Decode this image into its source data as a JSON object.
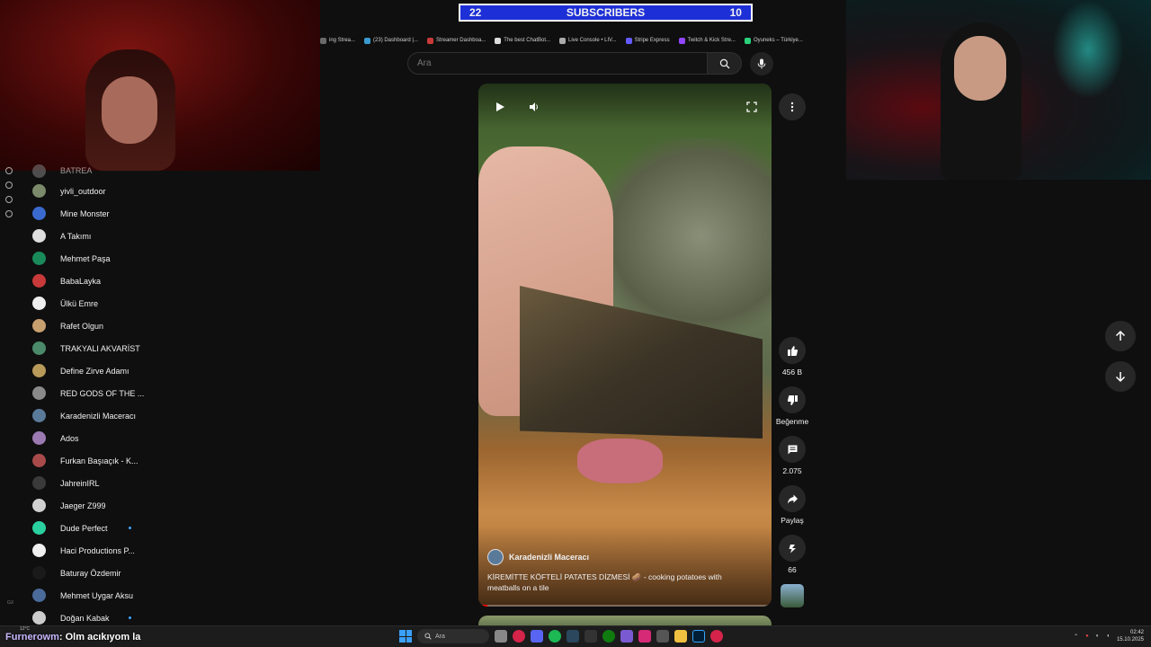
{
  "subscriber_bar": {
    "left": "22",
    "title": "SUBSCRIBERS",
    "right": "10"
  },
  "bookmarks": [
    "ing Strea...",
    "(23) Dashboard |...",
    "Streamer Dashboa...",
    "The best ChatBot...",
    "Live Console • LIV...",
    "Stripe Express",
    "Twitch & Kick Stre...",
    "Oyuneks – Türkiye..."
  ],
  "search": {
    "placeholder": "Ara"
  },
  "subscriptions": [
    {
      "name": "yivli_outdoor",
      "color": "#7a8a6a"
    },
    {
      "name": "Mine Monster",
      "color": "#3a6ad0"
    },
    {
      "name": "A Takımı",
      "color": "#dddddd"
    },
    {
      "name": "Mehmet Paşa",
      "color": "#1a8a5a"
    },
    {
      "name": "BabaLayka",
      "color": "#c83a3a"
    },
    {
      "name": "Ülkü Emre",
      "color": "#eeeeee"
    },
    {
      "name": "Rafet Olgun",
      "color": "#c8a070"
    },
    {
      "name": "TRAKYALI AKVARİST",
      "color": "#4a8a6a"
    },
    {
      "name": "Define Zirve Adamı",
      "color": "#b89a5a"
    },
    {
      "name": "RED GODS OF THE ...",
      "color": "#8a8a8a"
    },
    {
      "name": "Karadenizli Maceracı",
      "color": "#5a7a9a"
    },
    {
      "name": "Ados",
      "color": "#9a7ab0"
    },
    {
      "name": "Furkan Başıaçık - K...",
      "color": "#a84a4a"
    },
    {
      "name": "JahreinIRL",
      "color": "#3a3a3a"
    },
    {
      "name": "Jaeger Z999",
      "color": "#d0d0d0"
    },
    {
      "name": "Dude Perfect",
      "color": "#2ad0a0",
      "dot": true
    },
    {
      "name": "Haci Productions P...",
      "color": "#f0f0f0"
    },
    {
      "name": "Baturay Özdemir",
      "color": "#1a1a1a"
    },
    {
      "name": "Mehmet Uygar Aksu",
      "color": "#4a6a9a"
    },
    {
      "name": "Doğan Kabak",
      "color": "#cccccc",
      "dot": true
    }
  ],
  "partial_sub": "BATREA",
  "video": {
    "channel": "Karadenizli Maceracı",
    "caption": "KİREMİTTE KÖFTELİ PATATES DİZMESİ 🥔 - cooking potatoes with meatballs on a tile",
    "progress": 0.03
  },
  "actions": {
    "like_count": "456 B",
    "dislike_label": "Beğenme",
    "comment_count": "2.075",
    "share_label": "Paylaş",
    "remix_count": "66"
  },
  "chat": {
    "user": "Furnerowm",
    "message": ": Olm acıkıyom la"
  },
  "taskbar": {
    "search": "Ara",
    "temp": "12°C",
    "time": "02:42",
    "date": "15.10.2025"
  },
  "side_small": "GX"
}
